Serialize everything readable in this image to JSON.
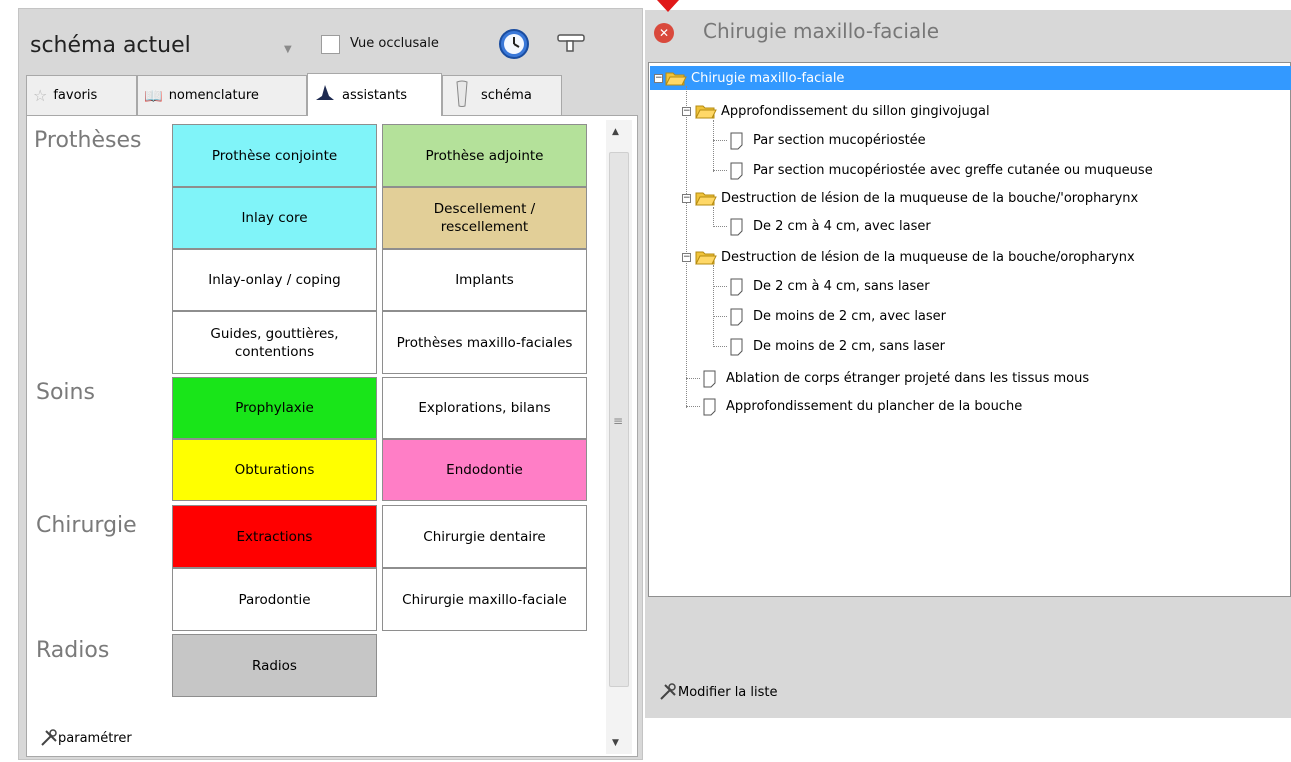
{
  "left": {
    "schema_select": "schéma actuel",
    "occlusal_label": "Vue occlusale",
    "tabs": [
      "favoris",
      "nomenclature",
      "assistants",
      "schéma"
    ],
    "categories": [
      "Prothèses",
      "Soins",
      "Chirurgie",
      "Radios"
    ],
    "buttons": [
      {
        "label": "Prothèse conjointe",
        "color": "#80f4f9"
      },
      {
        "label": "Prothèse adjointe",
        "color": "#b4e19a"
      },
      {
        "label": "Inlay core",
        "color": "#80f4f9"
      },
      {
        "label": "Descellement / rescellement",
        "color": "#e2cf98"
      },
      {
        "label": "Inlay-onlay / coping",
        "color": "#ffffff"
      },
      {
        "label": "Implants",
        "color": "#ffffff"
      },
      {
        "label": "Guides, gouttières, contentions",
        "color": "#ffffff"
      },
      {
        "label": "Prothèses maxillo-faciales",
        "color": "#ffffff"
      },
      {
        "label": "Prophylaxie",
        "color": "#19e519"
      },
      {
        "label": "Explorations, bilans",
        "color": "#ffffff"
      },
      {
        "label": "Obturations",
        "color": "#ffff00"
      },
      {
        "label": "Endodontie",
        "color": "#ff7ec6"
      },
      {
        "label": "Extractions",
        "color": "#ff0000"
      },
      {
        "label": "Chirurgie dentaire",
        "color": "#ffffff"
      },
      {
        "label": "Parodontie",
        "color": "#ffffff"
      },
      {
        "label": "Chirurgie maxillo-faciale",
        "color": "#ffffff"
      },
      {
        "label": "Radios",
        "color": "#c6c6c6"
      }
    ],
    "param_label": "paramétrer"
  },
  "right": {
    "title": "Chirugie maxillo-faciale",
    "tree": [
      "Chirugie maxillo-faciale",
      "Approfondissement du sillon gingivojugal",
      "Par section mucopériostée",
      "Par section mucopériostée avec greffe cutanée ou muqueuse",
      "Destruction de lésion de la muqueuse de la bouche/'oropharynx",
      "De 2 cm à 4 cm, avec laser",
      "Destruction de lésion de la muqueuse de la bouche/oropharynx",
      "De 2 cm à 4 cm, sans laser",
      "De moins de 2 cm, avec laser",
      "De moins de 2 cm, sans laser",
      "Ablation de corps étranger projeté dans les tissus mous",
      "Approfondissement du plancher de la bouche"
    ],
    "modify_label": "Modifier la liste"
  }
}
